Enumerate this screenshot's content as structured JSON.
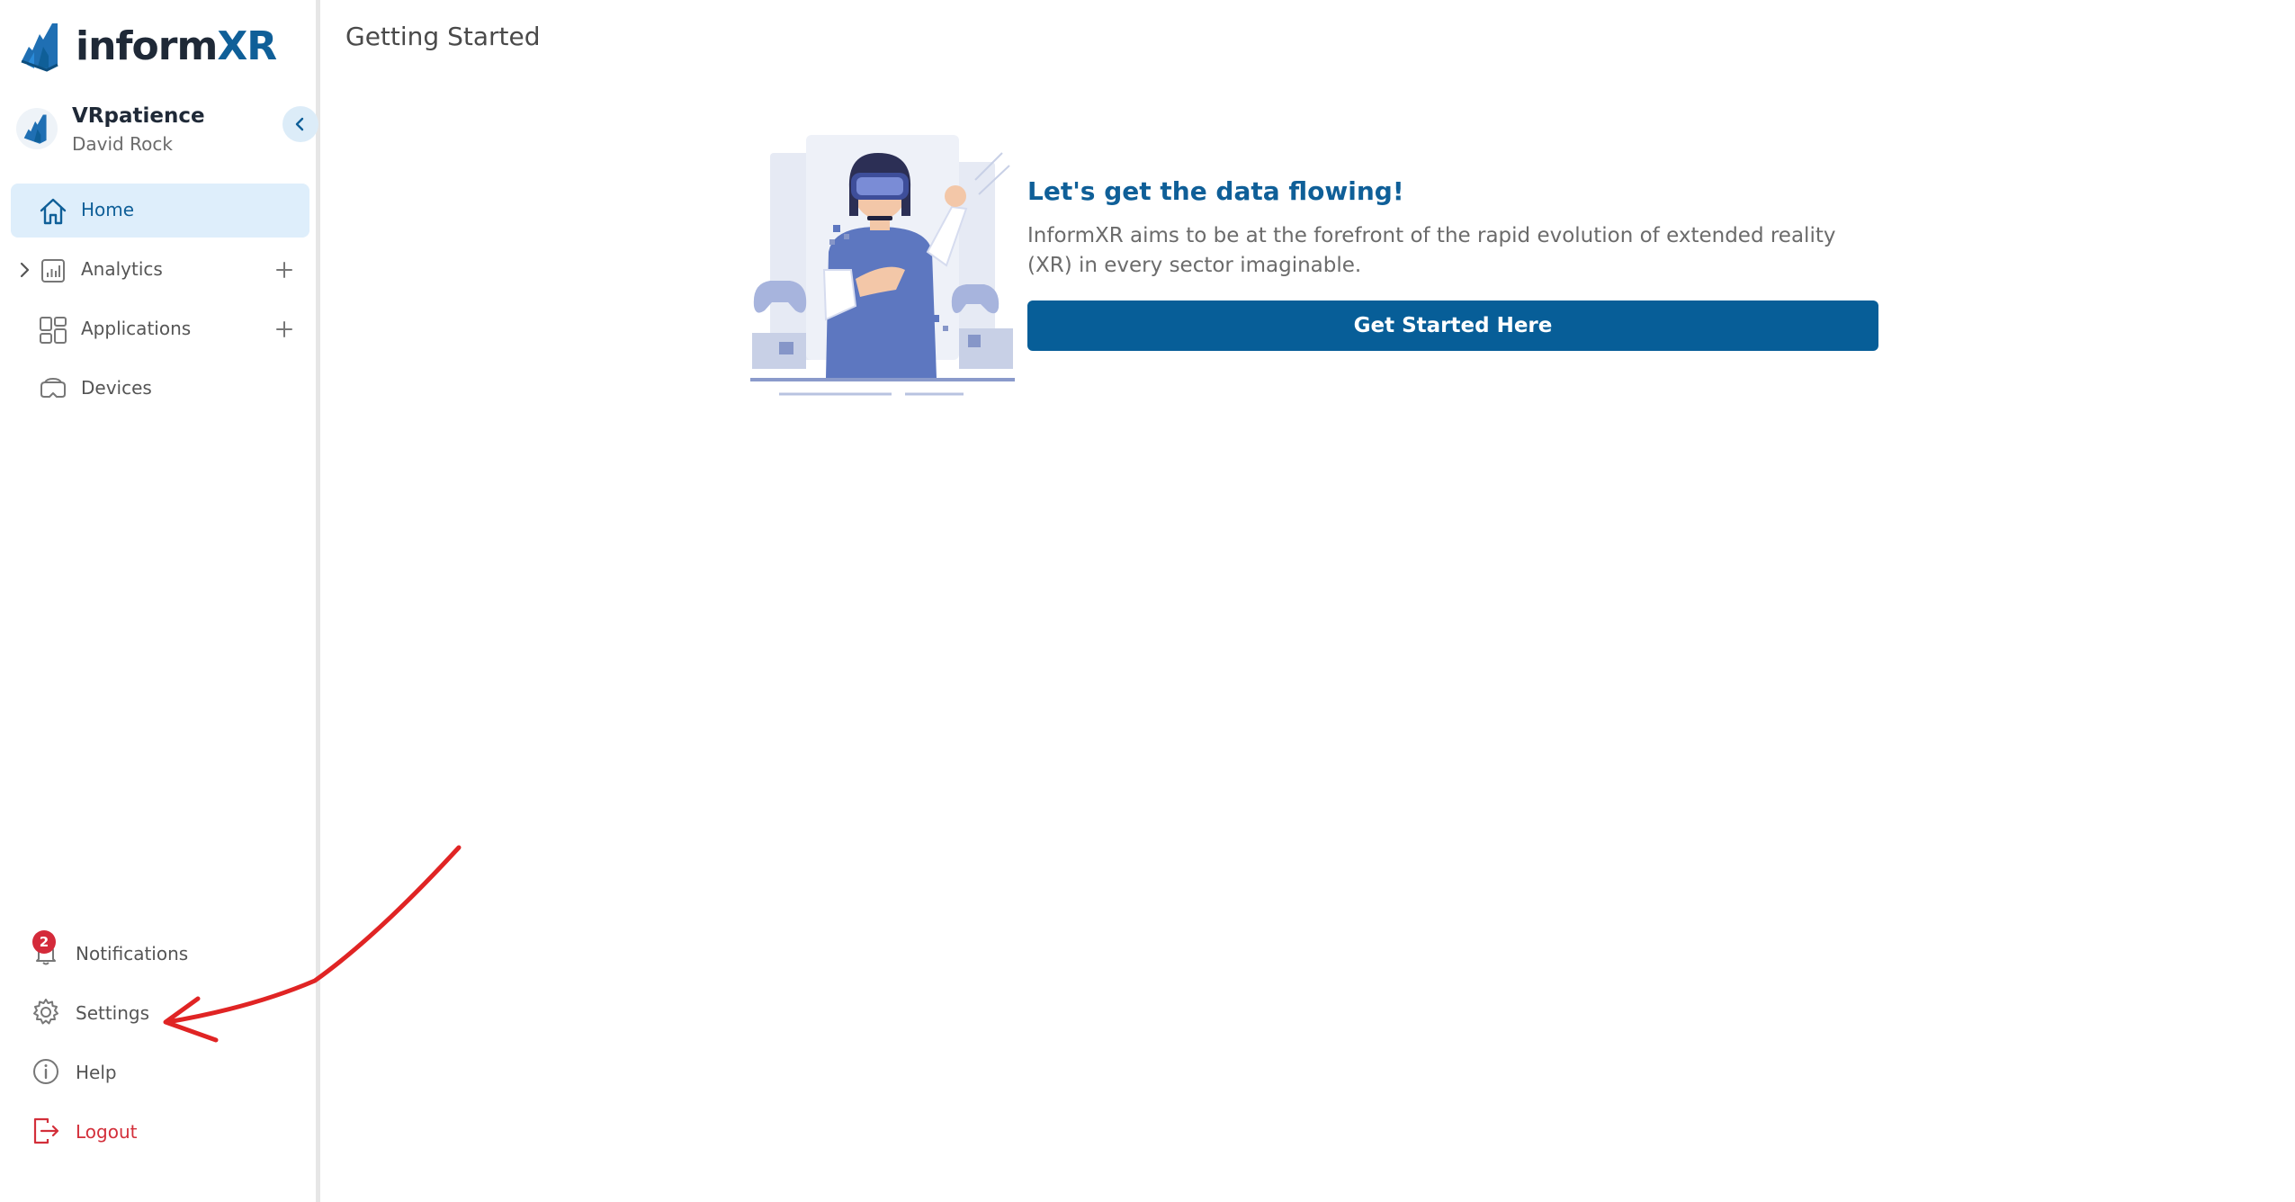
{
  "brand": {
    "logo_part1": "inform",
    "logo_part2": "XR"
  },
  "org": {
    "name": "VRpatience",
    "user": "David Rock"
  },
  "sidebar": {
    "items": [
      {
        "label": "Home",
        "active": true,
        "icon": "home-icon"
      },
      {
        "label": "Analytics",
        "expandable": true,
        "addable": true,
        "icon": "chart-icon"
      },
      {
        "label": "Applications",
        "addable": true,
        "icon": "grid-icon"
      },
      {
        "label": "Devices",
        "icon": "vr-headset-icon"
      }
    ],
    "bottom": [
      {
        "label": "Notifications",
        "badge": "2",
        "icon": "bell-icon"
      },
      {
        "label": "Settings",
        "icon": "gear-icon"
      },
      {
        "label": "Help",
        "icon": "info-icon"
      },
      {
        "label": "Logout",
        "icon": "logout-icon"
      }
    ]
  },
  "main": {
    "title": "Getting Started",
    "hero": {
      "heading": "Let's get the data flowing!",
      "description": "InformXR aims to be at the forefront of the rapid evolution of extended reality (XR) in every sector imaginable.",
      "cta_label": "Get Started Here"
    }
  },
  "colors": {
    "brand_dark": "#1f2937",
    "brand_blue": "#0f5f98",
    "button_blue": "#075e98",
    "active_bg": "#deeefb",
    "badge_red": "#d42a3a",
    "logout_red": "#d32f3a",
    "annotation_arrow": "#e02424"
  }
}
